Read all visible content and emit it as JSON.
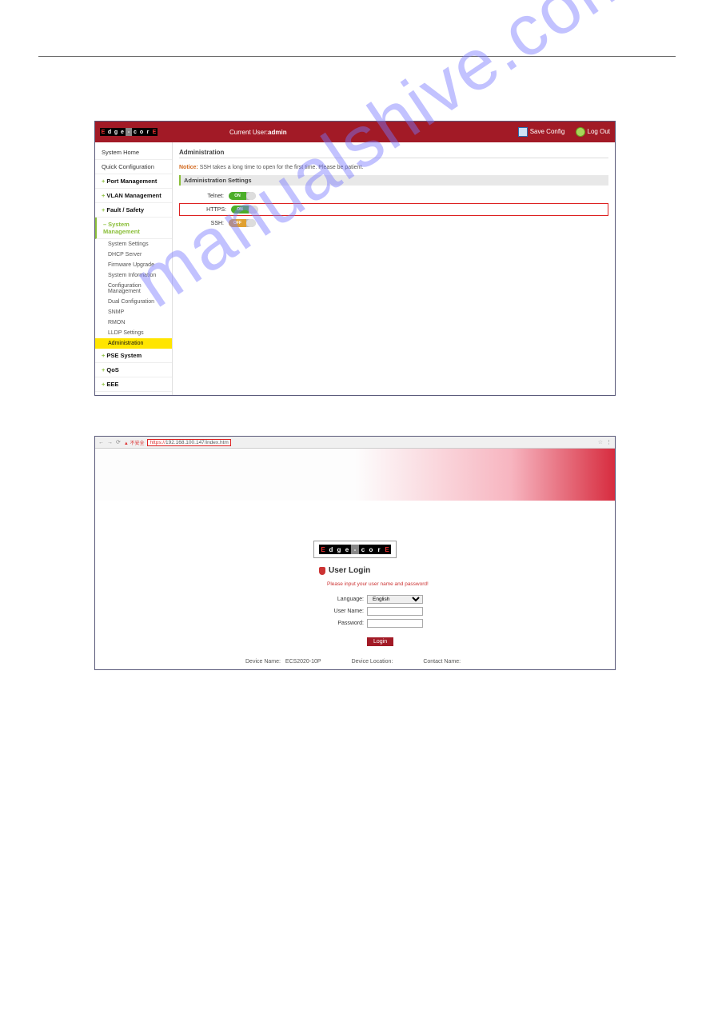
{
  "watermark": "manualshive.com",
  "topbar": {
    "logo_chars": [
      "E",
      "d",
      "g",
      "e",
      "-",
      "c",
      "o",
      "r",
      "E"
    ],
    "current_user_label": "Current User:",
    "current_user": "admin",
    "save_label": "Save Config",
    "logout_label": "Log Out"
  },
  "sidebar": {
    "items": [
      {
        "label": "System Home",
        "kind": "plain"
      },
      {
        "label": "Quick Configuration",
        "kind": "plain"
      },
      {
        "label": "Port Management",
        "kind": "plus"
      },
      {
        "label": "VLAN Management",
        "kind": "plus"
      },
      {
        "label": "Fault / Safety",
        "kind": "plus"
      },
      {
        "label": "System Management",
        "kind": "minus"
      },
      {
        "label": "PSE System",
        "kind": "plus"
      },
      {
        "label": "QoS",
        "kind": "plus"
      },
      {
        "label": "EEE",
        "kind": "plus"
      }
    ],
    "subitems": [
      "System Settings",
      "DHCP Server",
      "Firmware Upgrade",
      "System Information",
      "Configuration Management",
      "Dual Configuration",
      "SNMP",
      "RMON",
      "LLDP Settings",
      "Administration"
    ]
  },
  "content": {
    "title": "Administration",
    "notice_label": "Notice:",
    "notice_text": "SSH takes a long time to open for the first time. Please be patient.",
    "section_title": "Administration Settings",
    "rows": [
      {
        "label": "Telnet:",
        "state": "ON"
      },
      {
        "label": "HTTPS:",
        "state": "ON",
        "highlight": true
      },
      {
        "label": "SSH:",
        "state": "OFF"
      }
    ]
  },
  "browser": {
    "url_proto": "https://",
    "url_host": "192.168.100.147",
    "url_path": "/index.htm"
  },
  "login": {
    "logo_chars": [
      "E",
      "d",
      "g",
      "e",
      "-",
      "c",
      "o",
      "r",
      "E"
    ],
    "heading": "User Login",
    "hint": "Please input your user name and password!",
    "language_label": "Language:",
    "language_value": "English",
    "username_label": "User Name:",
    "password_label": "Password:",
    "login_button": "Login"
  },
  "footer": {
    "device_name_label": "Device Name:",
    "device_name_value": "ECS2020-10P",
    "device_location_label": "Device Location:",
    "contact_name_label": "Contact Name:"
  }
}
